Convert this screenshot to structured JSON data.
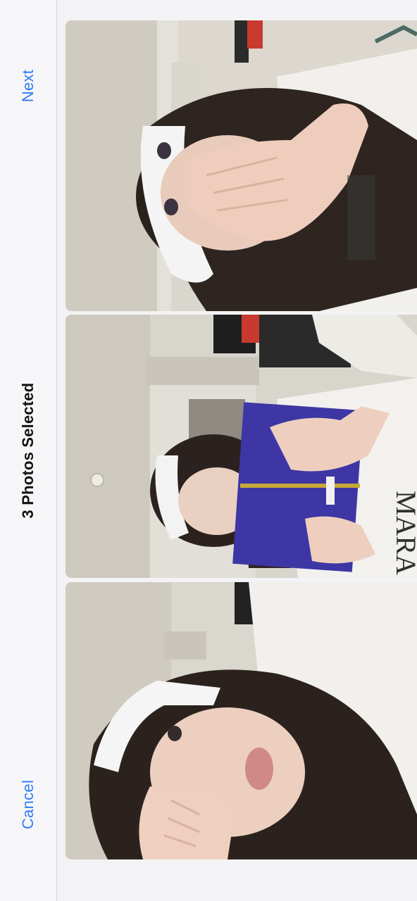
{
  "nav": {
    "next_label": "Next",
    "title": "3 Photos Selected",
    "cancel_label": "Cancel"
  },
  "colors": {
    "accent": "#2f7cf6",
    "title": "#111111",
    "background": "#f3f3f5"
  },
  "photos": [
    {
      "name": "photo-selfie-hand-over-face"
    },
    {
      "name": "photo-holding-blue-book"
    },
    {
      "name": "photo-selfie-hand-on-cheek"
    }
  ]
}
